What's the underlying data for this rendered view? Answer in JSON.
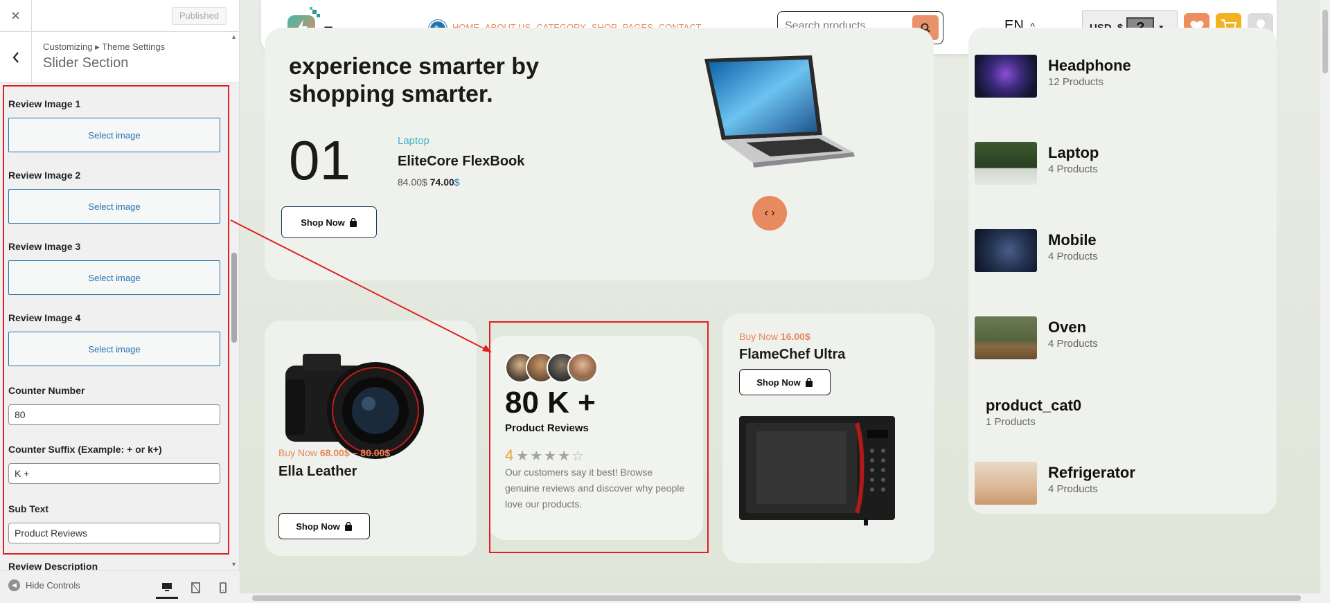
{
  "sidebar": {
    "close_icon": "×",
    "published_label": "Published",
    "breadcrumb": "Customizing ▸ Theme Settings",
    "section_title": "Slider Section",
    "controls": {
      "review_image_1_label": "Review Image 1",
      "review_image_2_label": "Review Image 2",
      "review_image_3_label": "Review Image 3",
      "review_image_4_label": "Review Image 4",
      "select_image_label": "Select image",
      "counter_number_label": "Counter Number",
      "counter_number_value": "80",
      "counter_suffix_label": "Counter Suffix (Example: + or k+)",
      "counter_suffix_value": "K +",
      "sub_text_label": "Sub Text",
      "sub_text_value": "Product Reviews",
      "review_description_label": "Review Description"
    },
    "hide_controls_label": "Hide Controls"
  },
  "header": {
    "logo_text": "Ecommerce",
    "nav": [
      "HOME",
      "ABOUT US",
      "CATEGORY",
      "SHOP",
      "PAGES",
      "CONTACT"
    ],
    "search_placeholder": "Search products...",
    "language": "EN",
    "language_caret": "^",
    "currency": "USD, $",
    "currency_icon": "?"
  },
  "hero": {
    "title": "experience smarter by shopping smarter.",
    "slide_number": "01",
    "category": "Laptop",
    "product_name": "EliteCore FlexBook",
    "old_price": "84.00",
    "new_price": "74.00",
    "currency_symbol": "$",
    "shop_label": "Shop Now",
    "slider_arrows": "‹ ›"
  },
  "categories": [
    {
      "name": "Headphone",
      "count": "12 Products",
      "color": "#2a1f5c"
    },
    {
      "name": "Laptop",
      "count": "4 Products",
      "color": "#2d4a2a"
    },
    {
      "name": "Mobile",
      "count": "4 Products",
      "color": "#1f2a44"
    },
    {
      "name": "Oven",
      "count": "4 Products",
      "color": "#4a5a3a"
    },
    {
      "name": "product_cat0",
      "count": "1 Products",
      "color": ""
    },
    {
      "name": "Refrigerator",
      "count": "4 Products",
      "color": "#c8a07a"
    }
  ],
  "cards": {
    "camera": {
      "buy_prefix": "Buy Now",
      "price": "68.00$ – 80.00$",
      "name": "Ella Leather",
      "shop_label": "Shop Now"
    },
    "flame": {
      "buy_prefix": "Buy Now",
      "price": "16.00$",
      "name": "FlameChef Ultra",
      "shop_label": "Shop Now"
    },
    "reviews": {
      "counter": "80 K +",
      "sub_text": "Product Reviews",
      "rating": "4",
      "stars_filled": 4,
      "stars_total": 5,
      "description": "Our customers say it best! Browse genuine reviews and discover why people love our products."
    }
  },
  "colors": {
    "accent": "#e8855a",
    "wp_blue": "#2271b1",
    "annotation_red": "#e02020"
  }
}
